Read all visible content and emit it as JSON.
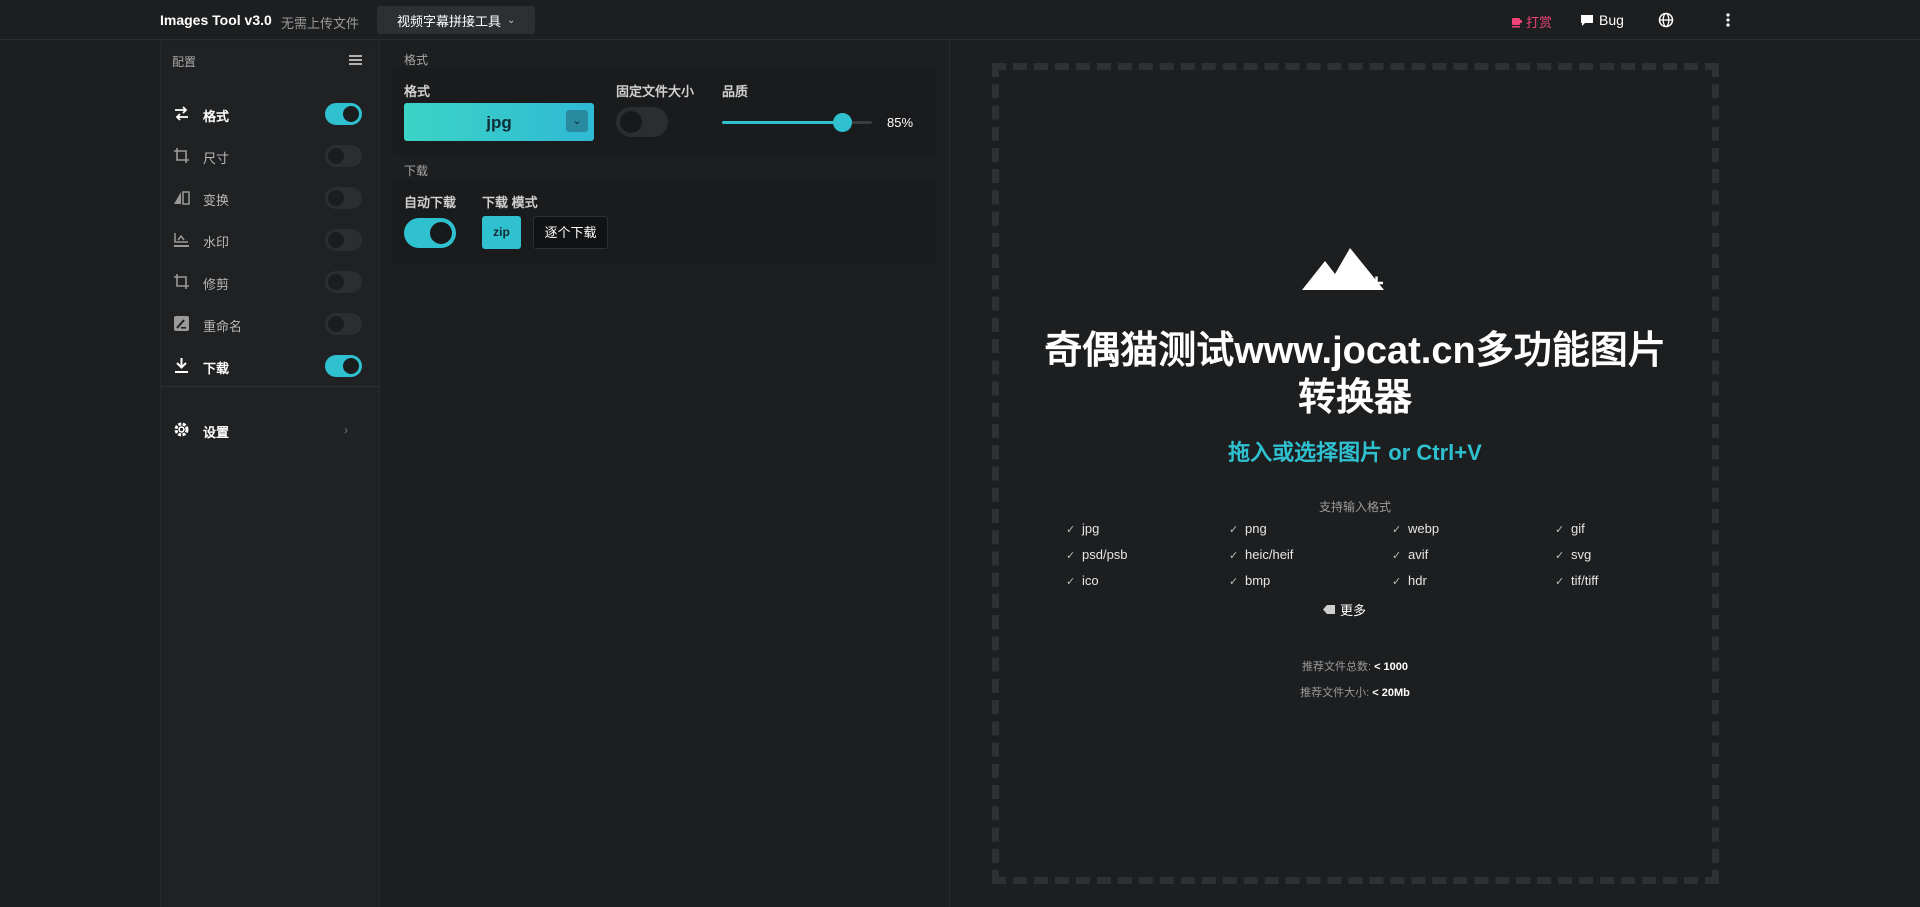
{
  "header": {
    "app_title": "Images Tool v3.0",
    "app_subtitle": "无需上传文件",
    "tool_dropdown": "视频字幕拼接工具",
    "donate": "打赏",
    "bug": "Bug"
  },
  "sidebar": {
    "heading": "配置",
    "items": [
      {
        "label": "格式",
        "on": true
      },
      {
        "label": "尺寸",
        "on": false
      },
      {
        "label": "变换",
        "on": false
      },
      {
        "label": "水印",
        "on": false
      },
      {
        "label": "修剪",
        "on": false
      },
      {
        "label": "重命名",
        "on": false
      },
      {
        "label": "下载",
        "on": true
      }
    ],
    "settings_label": "设置"
  },
  "format_section": {
    "title": "格式",
    "format_label": "格式",
    "format_value": "jpg",
    "fixed_size_label": "固定文件大小",
    "fixed_size_on": false,
    "quality_label": "品质",
    "quality_value": "85%",
    "quality_fraction": 0.85
  },
  "download_section": {
    "title": "下载",
    "auto_label": "自动下载",
    "auto_on": true,
    "mode_label": "下载 模式",
    "zip_label": "zip",
    "each_label": "逐个下载"
  },
  "dropzone": {
    "title": "奇偶猫测试www.jocat.cn多功能图片转换器",
    "subtitle": "拖入或选择图片 or Ctrl+V",
    "support_label": "支持输入格式",
    "formats": [
      "jpg",
      "png",
      "webp",
      "gif",
      "psd/psb",
      "heic/heif",
      "avif",
      "svg",
      "ico",
      "bmp",
      "hdr",
      "tif/tiff"
    ],
    "more_label": "更多",
    "total_label": "推荐文件总数:",
    "total_value": "< 1000",
    "size_label": "推荐文件大小:",
    "size_value": "< 20Mb"
  },
  "colors": {
    "accent": "#2fc1cf",
    "donate": "#f0437a",
    "background": "#1c1e20"
  }
}
